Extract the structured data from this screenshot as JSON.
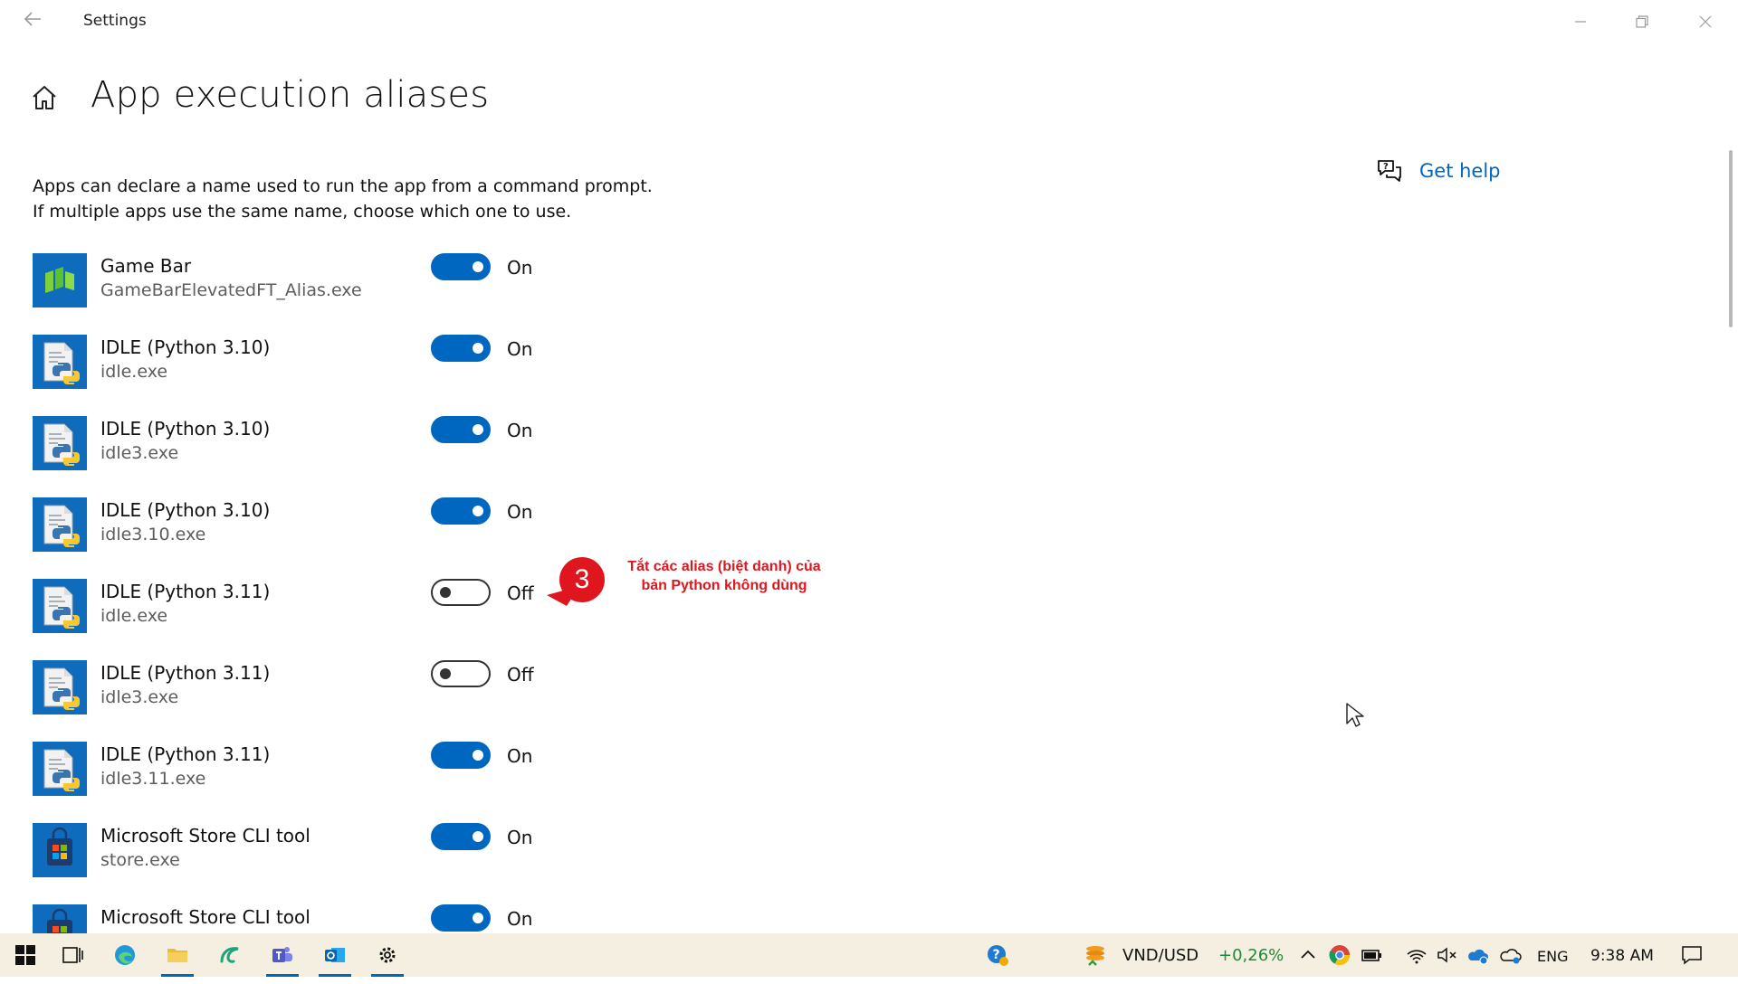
{
  "window": {
    "title": "Settings"
  },
  "page": {
    "title": "App execution aliases",
    "description_line1": "Apps can declare a name used to run the app from a command prompt.",
    "description_line2": "If multiple apps use the same name, choose which one to use.",
    "help_link": "Get help"
  },
  "aliases": [
    {
      "name": "Game Bar",
      "exe": "GameBarElevatedFT_Alias.exe",
      "state": "On",
      "enabled": true,
      "icon": "game-bar-icon"
    },
    {
      "name": "IDLE (Python 3.10)",
      "exe": "idle.exe",
      "state": "On",
      "enabled": true,
      "icon": "python-file-icon"
    },
    {
      "name": "IDLE (Python 3.10)",
      "exe": "idle3.exe",
      "state": "On",
      "enabled": true,
      "icon": "python-file-icon"
    },
    {
      "name": "IDLE (Python 3.10)",
      "exe": "idle3.10.exe",
      "state": "On",
      "enabled": true,
      "icon": "python-file-icon"
    },
    {
      "name": "IDLE (Python 3.11)",
      "exe": "idle.exe",
      "state": "Off",
      "enabled": false,
      "icon": "python-file-icon"
    },
    {
      "name": "IDLE (Python 3.11)",
      "exe": "idle3.exe",
      "state": "Off",
      "enabled": false,
      "icon": "python-file-icon"
    },
    {
      "name": "IDLE (Python 3.11)",
      "exe": "idle3.11.exe",
      "state": "On",
      "enabled": true,
      "icon": "python-file-icon"
    },
    {
      "name": "Microsoft Store CLI tool",
      "exe": "store.exe",
      "state": "On",
      "enabled": true,
      "icon": "store-icon"
    },
    {
      "name": "Microsoft Store CLI tool",
      "exe": "",
      "state": "On",
      "enabled": true,
      "icon": "store-icon"
    }
  ],
  "annotation": {
    "number": "3",
    "line1": "Tắt các alias (biệt danh) của",
    "line2": "bản Python không dùng",
    "color": "#e0161e"
  },
  "taskbar": {
    "currency_pair": "VND/USD",
    "currency_change": "+0,26%",
    "language": "ENG",
    "time": "9:38 AM"
  },
  "colors": {
    "accent": "#0067c0",
    "toggle_off_border": "#333333",
    "taskbar_bg": "#f4efe0"
  }
}
